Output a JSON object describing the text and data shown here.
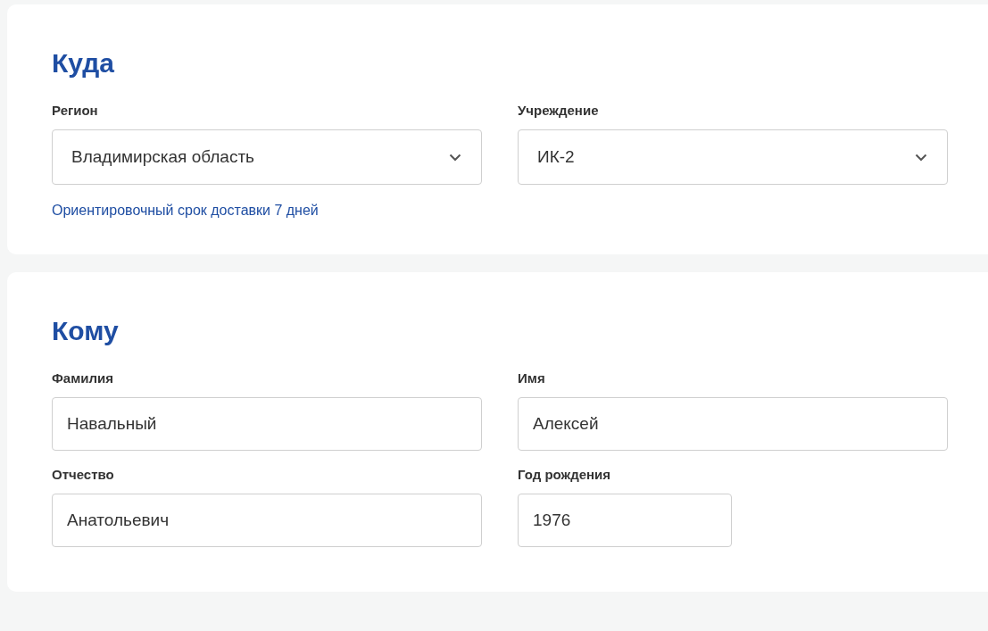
{
  "sections": [
    {
      "title": "Куда",
      "fields": [
        {
          "kind": "select",
          "label": "Регион",
          "value": "Владимирская область"
        },
        {
          "kind": "select",
          "label": "Учреждение",
          "value": "ИК-2"
        }
      ],
      "note": "Ориентировочный срок доставки 7 дней"
    },
    {
      "title": "Кому",
      "fields": [
        {
          "kind": "text",
          "label": "Фамилия",
          "value": "Навальный"
        },
        {
          "kind": "text",
          "label": "Имя",
          "value": "Алексей"
        },
        {
          "kind": "text",
          "label": "Отчество",
          "value": "Анатольевич"
        },
        {
          "kind": "short-text",
          "label": "Год рождения",
          "value": "1976"
        }
      ]
    }
  ]
}
